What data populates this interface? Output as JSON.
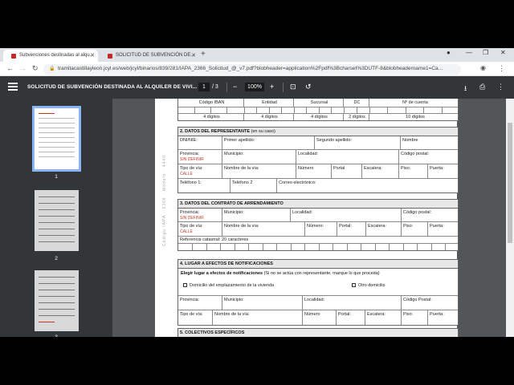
{
  "browser": {
    "tab1_title": "Subvenciones destinadas al alqu...",
    "tab2_title": "SOLICITUD DE SUBVENCIÓN DE...",
    "url": "tramitacastillayleon.jcyl.es/web/jcyl/binarios/839/281/IAPA_2366_Solicitud_@_v7.pdf?blobheader=application%2Fpdf%3Bcharset%3DUTF-8&blobheadername1=Ca..."
  },
  "pdf_toolbar": {
    "title": "SOLICITUD DE SUBVENCIÓN DESTINADA AL ALQUILER DE VIVI...",
    "page_current": "1",
    "page_total": "/ 3",
    "zoom": "100%"
  },
  "thumbnails": [
    "1",
    "2",
    "3"
  ],
  "watermark": "Código IAPA · 2366 · Modelo · 4440",
  "bank": {
    "headers": [
      "Código IBAN",
      "Entidad",
      "Sucursal",
      "DC",
      "Nº de cuenta"
    ],
    "digits": [
      "4 dígitos",
      "4 dígitos",
      "4 dígitos",
      "2 dígitos",
      "10 dígitos"
    ]
  },
  "sec2": {
    "title": "2. DATOS DEL REPRESENTANTE",
    "subtitle": "(en su caso)",
    "dni": "DNI/NIE:",
    "apellido1": "Primer apellido:",
    "apellido2": "Segundo apellido:",
    "nombre": "Nombre",
    "provincia": "Provincia:",
    "provincia_val": "SIN DEFINIR",
    "municipio": "Municipio:",
    "localidad": "Localidad:",
    "cp": "Código postal:",
    "tipo_via": "Tipo de vía:",
    "tipo_via_val": "CALLE",
    "nombre_via": "Nombre de la vía:",
    "numero": "Número",
    "portal": "Portal",
    "escalera": "Escalera:",
    "piso": "Piso:",
    "puerta": "Puerta:",
    "tel1": "Teléfono 1:",
    "tel2": "Teléfono 2",
    "email": "Correo electrónico:"
  },
  "sec3": {
    "title": "3. DATOS DEL CONTRATO DE ARRENDAMIENTO",
    "provincia": "Provincia:",
    "provincia_val": "SIN DEFINIR",
    "municipio": "Municipio:",
    "localidad": "Localidad:",
    "cp": "Código postal:",
    "tipo_via": "Tipo de vía:",
    "tipo_via_val": "CALLE",
    "nombre_via": "Nombre de la vía:",
    "numero": "Número:",
    "portal": "Portal:",
    "escalera": "Escalera:",
    "piso": "Piso:",
    "puerta": "Puerta:",
    "catastral": "Referencia catastral: 20 caracteres"
  },
  "sec4": {
    "title": "4. LUGAR A EFECTOS DE NOTIFICACIONES",
    "elegir": "Elegir lugar a efectos de notificaciones",
    "elegir_note": "(Si no se actúa con representante, marque lo que proceda)",
    "opt1": "Domicilio del emplazamiento de la vivienda",
    "opt2": "Otro domicilio",
    "provincia": "Provincia:",
    "municipio": "Municipio:",
    "localidad": "Localidad:",
    "cp": "Código Postal:",
    "tipo_via": "Tipo de vía:",
    "nombre_via": "Nombre de la vía:",
    "numero": "Número",
    "portal": "Portal:",
    "escalera": "Escalera:",
    "piso": "Piso:",
    "puerta": "Puerta:"
  },
  "sec5": {
    "title": "5. COLECTIVOS ESPECÍFICOS"
  }
}
